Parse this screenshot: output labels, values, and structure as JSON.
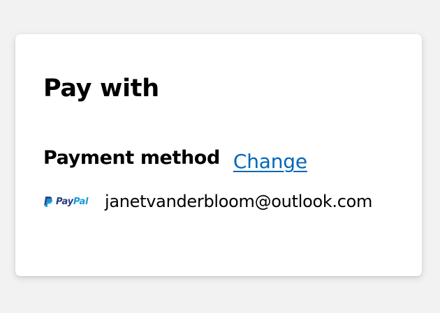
{
  "card": {
    "title": "Pay with",
    "payment_method": {
      "label": "Payment method",
      "change_label": "Change"
    },
    "account": {
      "provider": {
        "pay": "Pay",
        "pal": "Pal",
        "icon": "paypal-logo",
        "colors": {
          "dark_blue": "#253b80",
          "light_blue": "#179bd7"
        }
      },
      "email": "janetvanderbloom@outlook.com"
    }
  },
  "colors": {
    "background": "#f2f2f2",
    "card": "#ffffff",
    "link": "#0067b8"
  }
}
